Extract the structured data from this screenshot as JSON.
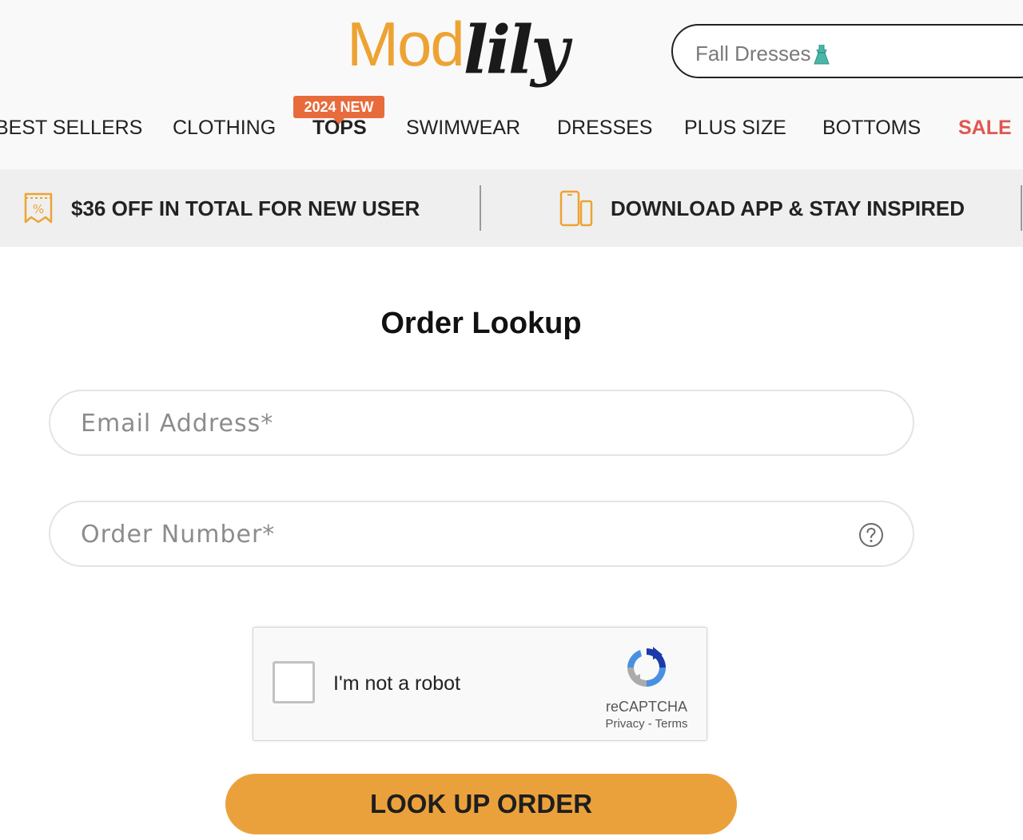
{
  "brand": {
    "logo_part1": "Mod",
    "logo_part2": "lily",
    "accent_color": "#eda333"
  },
  "search": {
    "placeholder": "Fall Dresses"
  },
  "nav": {
    "badge": "2024 NEW",
    "items": [
      "BEST SELLERS",
      "CLOTHING",
      "TOPS",
      "SWIMWEAR",
      "DRESSES",
      "PLUS SIZE",
      "BOTTOMS",
      "SALE"
    ],
    "sale_color": "#e0574f"
  },
  "promo": {
    "items": [
      {
        "icon": "coupon-icon",
        "text": "$36 OFF IN TOTAL FOR NEW USER"
      },
      {
        "icon": "phone-icon",
        "text": "DOWNLOAD APP & STAY INSPIRED"
      }
    ]
  },
  "page": {
    "title": "Order Lookup"
  },
  "form": {
    "email_placeholder": "Email Address*",
    "order_placeholder": "Order Number*",
    "submit_label": "LOOK UP ORDER",
    "submit_color": "#eba13b"
  },
  "captcha": {
    "label": "I'm not a robot",
    "brand": "reCAPTCHA",
    "links": "Privacy - Terms"
  }
}
